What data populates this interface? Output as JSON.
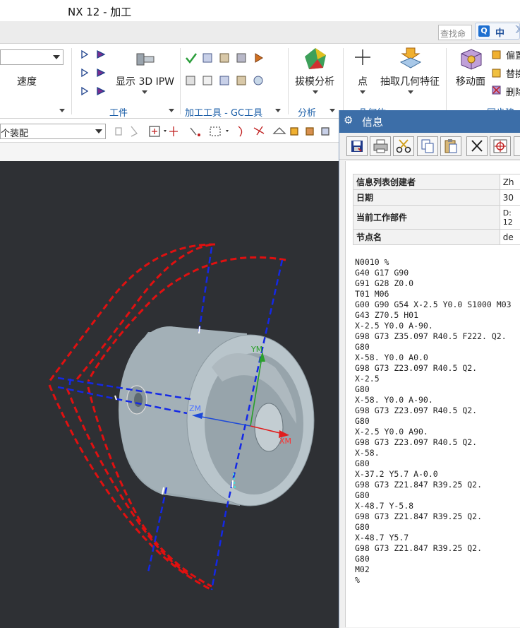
{
  "window": {
    "title": "NX 12 - 加工"
  },
  "search": {
    "placeholder": "查找命",
    "ime_q": "Q",
    "ime_lang": "中",
    "ime_moon": "☽"
  },
  "ribbon": {
    "speed_label": "速度",
    "show_ipw_label": "显示 3D IPW",
    "group_workpiece": "工件",
    "group_machining_tools": "加工工具 - GC工具",
    "draft_analysis_label": "拔模分析",
    "group_analysis": "分析",
    "point_label": "点",
    "extract_geometry_label": "抽取几何特征",
    "group_geometry": "几何体",
    "move_face_label": "移动面",
    "offset_label": "偏置",
    "replace_label": "替换",
    "delete_label": "删除",
    "group_sync": "同步建"
  },
  "toolbar2": {
    "assembly_combo": "个装配"
  },
  "info_window": {
    "title": "信息",
    "meta": [
      {
        "key": "信息列表创建者",
        "value": "Zh"
      },
      {
        "key": "日期",
        "value": "30"
      },
      {
        "key": "当前工作部件",
        "value": "D:\n12"
      },
      {
        "key": "节点名",
        "value": "de"
      }
    ],
    "nc_code": "N0010 %\nG40 G17 G90\nG91 G28 Z0.0\nT01 M06\nG00 G90 G54 X-2.5 Y0.0 S1000 M03\nG43 Z70.5 H01\nX-2.5 Y0.0 A-90.\nG98 G73 Z35.097 R40.5 F222. Q2.\nG80\nX-58. Y0.0 A0.0\nG98 G73 Z23.097 R40.5 Q2.\nX-2.5\nG80\nX-58. Y0.0 A-90.\nG98 G73 Z23.097 R40.5 Q2.\nG80\nX-2.5 Y0.0 A90.\nG98 G73 Z23.097 R40.5 Q2.\nX-58.\nG80\nX-37.2 Y5.7 A-0.0\nG98 G73 Z21.847 R39.25 Q2.\nG80\nX-48.7 Y-5.8\nG98 G73 Z21.847 R39.25 Q2.\nG80\nX-48.7 Y5.7\nG98 G73 Z21.847 R39.25 Q2.\nG80\nM02\n%"
  },
  "viewport": {
    "axis_ym": "YM",
    "axis_zm": "ZM",
    "axis_xm": "XM"
  },
  "colors": {
    "accent": "#3c6ea8",
    "group_label": "#1c5fa8",
    "toolpath": "#e01010",
    "feed_line": "#1020e0",
    "viewport_bg": "#2e3034",
    "part": "#a9b6bd"
  }
}
